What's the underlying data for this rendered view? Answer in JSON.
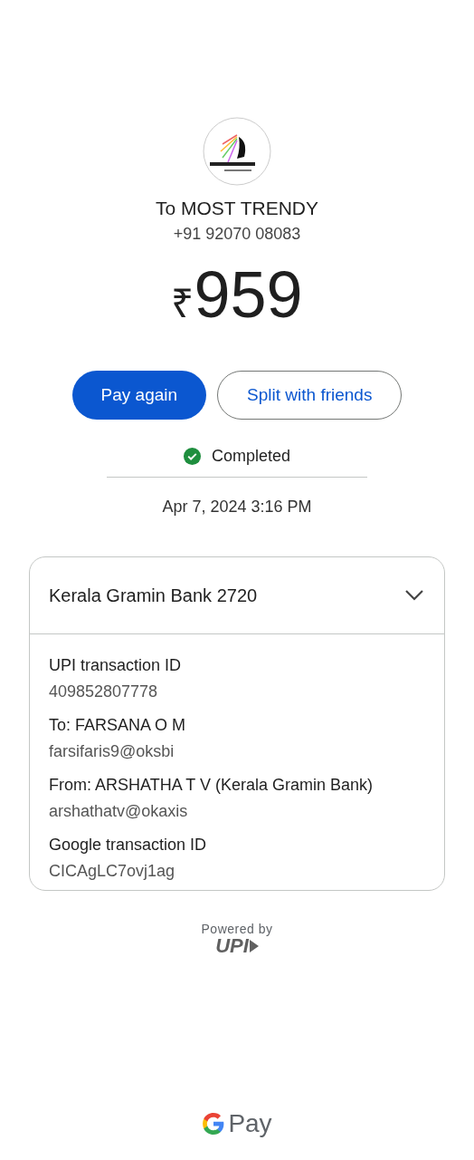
{
  "merchant": {
    "name": "To MOST TRENDY",
    "phone": "+91 92070 08083"
  },
  "amount": {
    "currency": "₹",
    "value": "959"
  },
  "actions": [
    {
      "label": "Pay again",
      "kind": "primary"
    },
    {
      "label": "Split with friends",
      "kind": "outline"
    }
  ],
  "status": {
    "label": "Completed",
    "completed": true
  },
  "datetime": "Apr 7, 2024 3:16 PM",
  "details": {
    "account": "Kerala Gramin Bank 2720",
    "expanded": true,
    "fields": [
      {
        "label": "UPI transaction ID",
        "value": "409852807778"
      },
      {
        "label": "To: FARSANA O M",
        "value": "farsifaris9@oksbi"
      },
      {
        "label": "From: ARSHATHA T V (Kerala Gramin Bank)",
        "value": "arshathatv@okaxis"
      },
      {
        "label": "Google transaction ID",
        "value": "CICAgLC7ovj1ag"
      }
    ]
  },
  "powered_by": {
    "label": "Powered by",
    "logo": "UPI"
  },
  "footer": {
    "brand": "Pay"
  }
}
